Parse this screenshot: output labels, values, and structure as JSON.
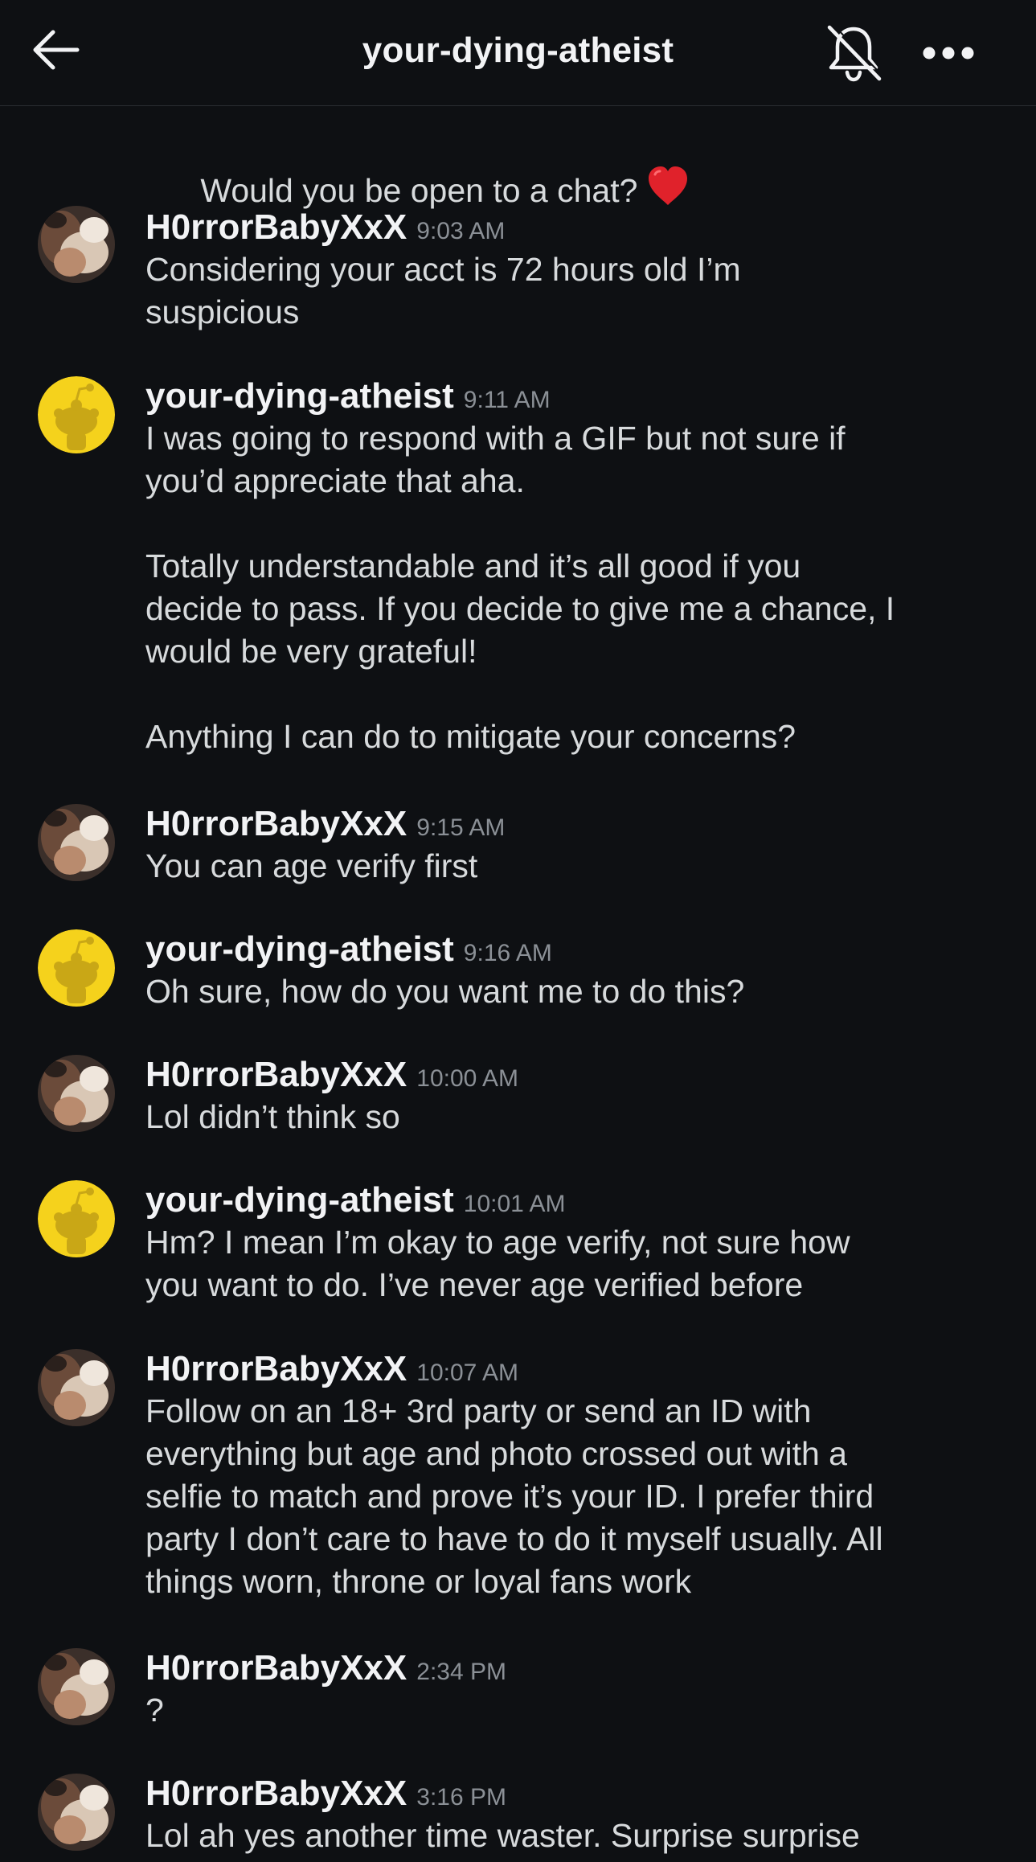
{
  "header": {
    "title": "your-dying-atheist",
    "back_icon": "arrow-left-icon",
    "notifications_icon": "bell-off-icon",
    "more_icon": "more-horizontal-icon"
  },
  "colors": {
    "background": "#0e1013",
    "text": "#d7dadc",
    "author": "#f2f3f5",
    "timestamp": "#8b9096",
    "snoo_avatar": "#f5d21c",
    "heart": "#e0222b"
  },
  "messages": [
    {
      "author": "",
      "time": "",
      "text": "Would you be open to a chat?",
      "emoji": "red-heart-icon"
    },
    {
      "author": "H0rrorBabyXxX",
      "time": "9:03 AM",
      "avatar": "user-photo-avatar",
      "text": "Considering your acct is 72 hours old I’m\nsuspicious"
    },
    {
      "author": "your-dying-atheist",
      "time": "9:11 AM",
      "avatar": "snoo-avatar",
      "text": "I was going to respond with a GIF but not sure if\nyou’d appreciate that aha.\n\nTotally understandable and it’s all good if you\ndecide to pass. If you decide to give me a chance, I\nwould be very grateful!\n\nAnything I can do to mitigate your concerns?"
    },
    {
      "author": "H0rrorBabyXxX",
      "time": "9:15 AM",
      "avatar": "user-photo-avatar",
      "text": "You can age verify first"
    },
    {
      "author": "your-dying-atheist",
      "time": "9:16 AM",
      "avatar": "snoo-avatar",
      "text": "Oh sure, how do you want me to do this?"
    },
    {
      "author": "H0rrorBabyXxX",
      "time": "10:00 AM",
      "avatar": "user-photo-avatar",
      "text": "Lol didn’t think so"
    },
    {
      "author": "your-dying-atheist",
      "time": "10:01 AM",
      "avatar": "snoo-avatar",
      "text": "Hm? I mean I’m okay to age verify, not sure how\nyou want to do. I’ve never age verified before"
    },
    {
      "author": "H0rrorBabyXxX",
      "time": "10:07 AM",
      "avatar": "user-photo-avatar",
      "text": "Follow on an 18+ 3rd party or send an ID with\neverything but age and photo crossed out with a\nselfie to match and prove it’s your ID. I prefer third\nparty I don’t care to have to do it myself usually. All\nthings worn, throne or loyal fans work"
    },
    {
      "author": "H0rrorBabyXxX",
      "time": "2:34 PM",
      "avatar": "user-photo-avatar",
      "text": "?"
    },
    {
      "author": "H0rrorBabyXxX",
      "time": "3:16 PM",
      "avatar": "user-photo-avatar",
      "text": "Lol ah yes another time waster. Surprise surprise"
    }
  ]
}
